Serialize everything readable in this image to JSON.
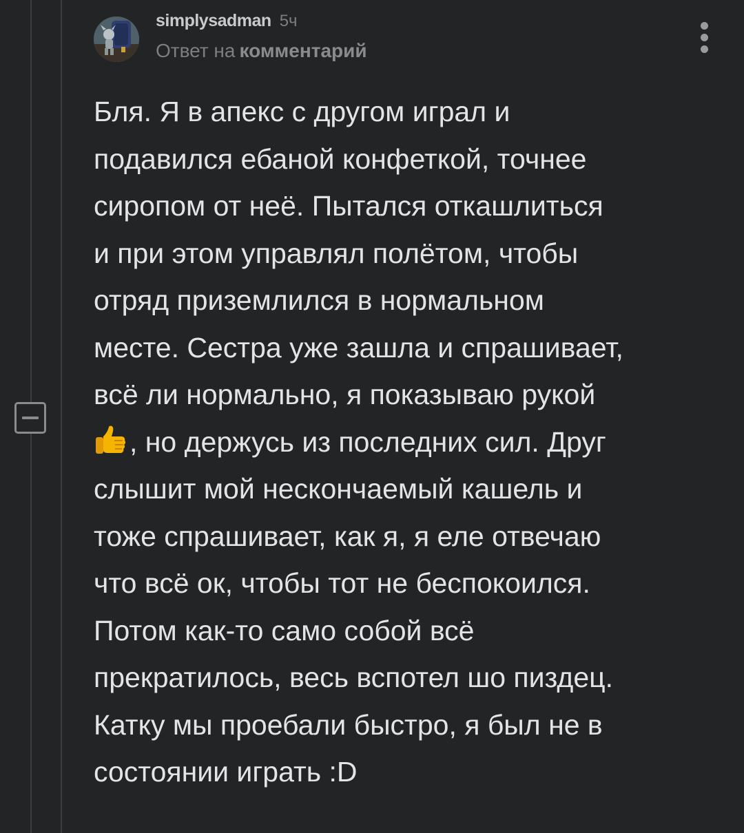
{
  "comment": {
    "author": "simplysadman",
    "time": "5ч",
    "reply_prefix": "Ответ на",
    "reply_link": "комментарий",
    "body_before_emoji": "Бля. Я в апекс с другом играл и\nподавился ебаной конфеткой, точнее\nсиропом от неё. Пытался откашлиться\nи при этом управлял полётом, чтобы\nотряд приземлился в нормальном\nместе. Сестра уже зашла и спрашивает,\nвсё ли нормально, я показываю рукой\n",
    "emoji": "thumbs-up-icon",
    "body_after_emoji": ", но держусь из последних сил. Друг\nслышит мой нескончаемый кашель и\nтоже спрашивает, как я, я еле отвечаю\nчто всё ок, чтобы тот не беспокоился.\nПотом как-то само собой всё\nпрекратилось, весь вспотел шо пиздец.\nКатку мы проебали быстро, я был не в\nсостоянии играть :D"
  },
  "colors": {
    "background": "#232426",
    "text": "#e3e4e6",
    "muted": "#7d7e81",
    "thread_line": "#3c3d40",
    "emoji": "#f4b400"
  }
}
